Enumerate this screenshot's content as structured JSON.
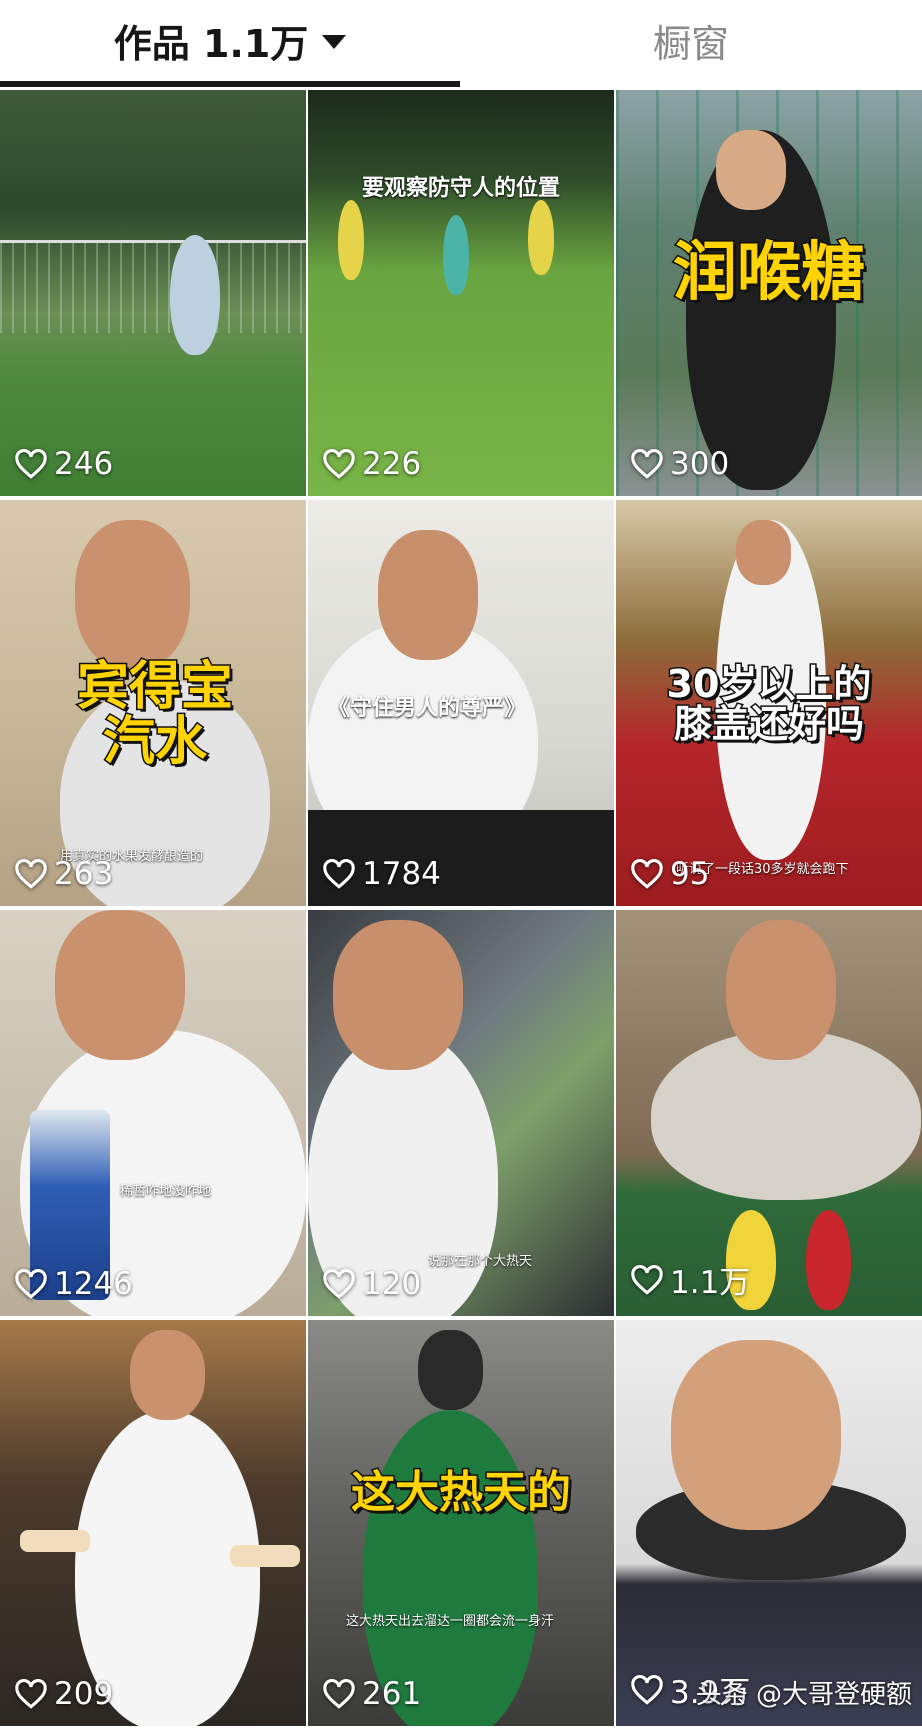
{
  "tabs": [
    {
      "label": "作品 1.1万",
      "active": true
    },
    {
      "label": "橱窗",
      "active": false
    }
  ],
  "videos": [
    {
      "likes": "246",
      "caption": "",
      "subcaption": ""
    },
    {
      "likes": "226",
      "caption": "要观察防守人的位置",
      "subcaption": ""
    },
    {
      "likes": "300",
      "caption": "润喉糖",
      "subcaption": ""
    },
    {
      "likes": "263",
      "caption": "宾得宝\n汽水",
      "subcaption": "用真实的水果发酵酿造的"
    },
    {
      "likes": "1784",
      "caption": "《守住男人的尊严》",
      "subcaption": ""
    },
    {
      "likes": "95",
      "caption": "30岁以上的\n膝盖还好吗",
      "subcaption": "听说了一段话30多岁就会跑下"
    },
    {
      "likes": "1246",
      "caption": "",
      "subcaption": "稀哲咋地没咋地"
    },
    {
      "likes": "120",
      "caption": "",
      "subcaption": "说那在那个大热天"
    },
    {
      "likes": "1.1万",
      "caption": "",
      "subcaption": ""
    },
    {
      "likes": "209",
      "caption": "",
      "subcaption": ""
    },
    {
      "likes": "261",
      "caption": "这大热天的",
      "subcaption": "这大热天出去溜达一圈都会流一身汗"
    },
    {
      "likes": "3.9万",
      "caption": "",
      "subcaption": ""
    }
  ],
  "watermark": {
    "text": "头条 @大哥登硬额"
  },
  "colors": {
    "caption_yellow": "#ffd400",
    "tab_active": "#161616",
    "tab_inactive": "#8a8a8a"
  },
  "icons": {
    "like": "heart-outline-icon",
    "dropdown": "caret-down-icon"
  }
}
